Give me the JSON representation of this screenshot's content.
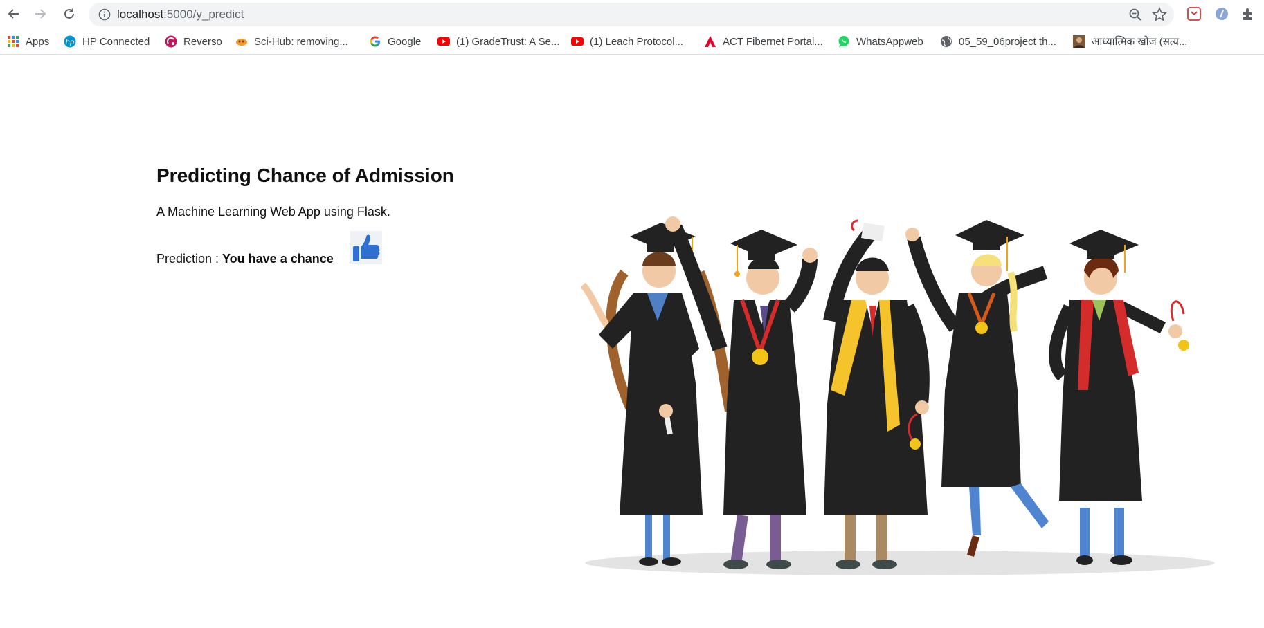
{
  "browser": {
    "url_host": "localhost",
    "url_path": ":5000/y_predict",
    "icons": [
      "back-icon",
      "forward-icon",
      "reload-icon",
      "info-icon",
      "zoom-icon",
      "star-icon",
      "extensions-icon"
    ]
  },
  "bookmarks": [
    {
      "label": "Apps",
      "icon": "apps-grid-icon"
    },
    {
      "label": "HP Connected",
      "icon": "hp-logo-icon"
    },
    {
      "label": "Reverso",
      "icon": "reverso-icon"
    },
    {
      "label": "Sci-Hub: removing...",
      "icon": "scihub-icon"
    },
    {
      "label": "Google",
      "icon": "google-icon"
    },
    {
      "label": "(1) GradeTrust: A Se...",
      "icon": "youtube-icon"
    },
    {
      "label": "(1) Leach Protocol...",
      "icon": "youtube-icon"
    },
    {
      "label": "ACT Fibernet Portal...",
      "icon": "act-logo-icon"
    },
    {
      "label": "WhatsAppweb",
      "icon": "whatsapp-icon"
    },
    {
      "label": "05_59_06project th...",
      "icon": "globe-icon"
    },
    {
      "label": "आध्यात्मिक खोज (सत्य...",
      "icon": "avatar-icon"
    }
  ],
  "page": {
    "title": "Predicting Chance of Admission",
    "subtitle": "A Machine Learning Web App using Flask.",
    "prediction_label": "Prediction : ",
    "prediction_value": "You have a chance"
  },
  "colors": {
    "accent_blue": "#1a73e8",
    "thumb_blue": "#2f6fd0",
    "gown_black": "#222222"
  }
}
